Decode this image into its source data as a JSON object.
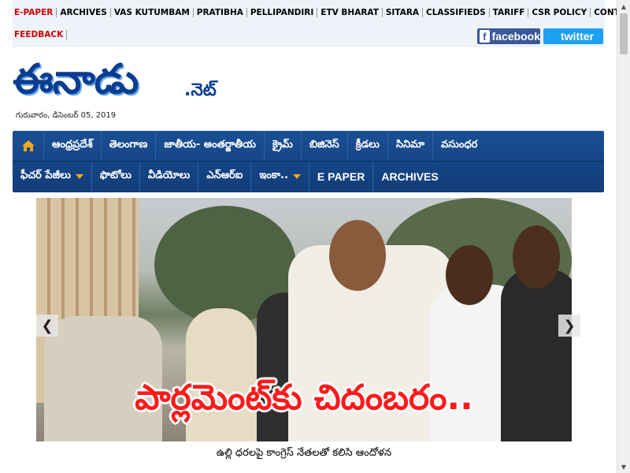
{
  "top_links": [
    "E-PAPER",
    "ARCHIVES",
    "VAS KUTUMBAM",
    "PRATIBHA",
    "PELLIPANDIRI",
    "ETV BHARAT",
    "SITARA",
    "CLASSIFIEDS",
    "TARIFF",
    "CSR POLICY",
    "CONTACT"
  ],
  "feedback_label": "FEEDBACK",
  "social": {
    "facebook": "facebook",
    "twitter": "twitter"
  },
  "logo": {
    "main": "ఈనాడు",
    "suffix": ".నెట్"
  },
  "date": "గురువారం, డిసెంబర్ 05, 2019",
  "nav": {
    "row1": [
      "ఆంధ్రప్రదేశ్",
      "తెలంగాణ",
      "జాతీయ- అంతర్జాతీయ",
      "క్రైమ్",
      "బిజినెస్",
      "క్రీడలు",
      "సినిమా",
      "వసుంధర"
    ],
    "row2": [
      "ఫీచర్ పేజీలు",
      "ఫొటోలు",
      "వీడియోలు",
      "ఎన్‌ఆర్‌ఐ",
      "ఇంకా..",
      "E PAPER",
      "ARCHIVES"
    ]
  },
  "slider": {
    "headline": "పార్లమెంట్‌కు చిదంబరం..",
    "caption": "ఉల్లి ధరలపై కాంగ్రెస్ నేతలతో కలిసి ఆందోళన"
  },
  "colors": {
    "nav_bg": "#1a4f95",
    "accent_red": "#cc0000",
    "logo_blue": "#0a3d8f",
    "caret_orange": "#f3a71c"
  }
}
